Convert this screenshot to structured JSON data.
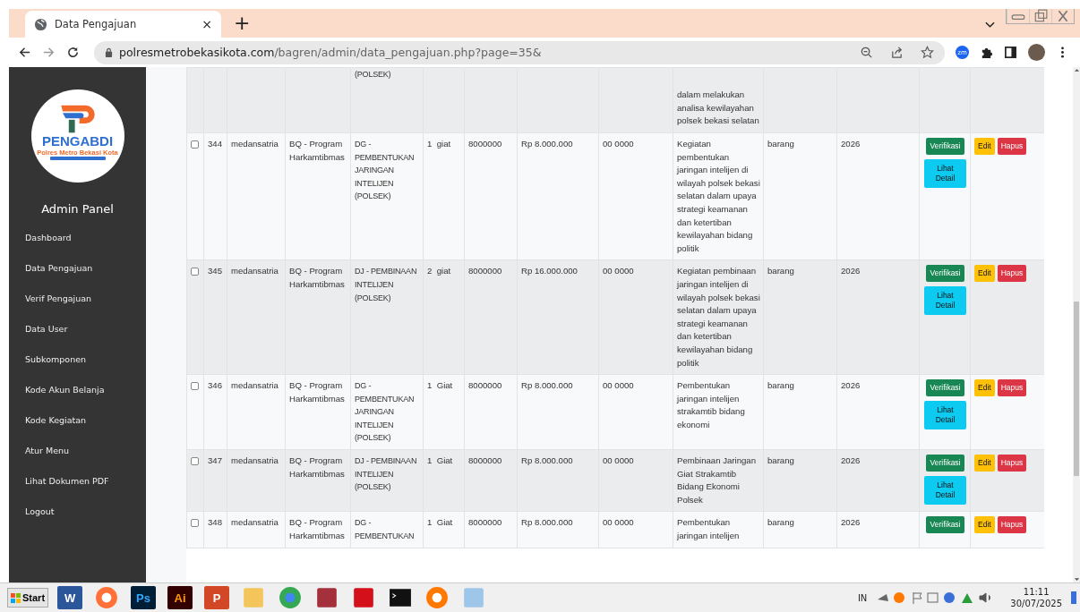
{
  "browser": {
    "tab_title": "Data Pengajuan",
    "tab_close": "×",
    "new_tab": "+",
    "url_host": "polresmetrobekasikota.com",
    "url_path": "/bagren/admin/data_pengajuan.php?page=35&",
    "extension_label": "zm"
  },
  "sidebar": {
    "logo_text": "PENGABDI",
    "logo_subtitle": "Polres Metro Bekasi Kota",
    "title": "Admin Panel",
    "items": [
      {
        "label": "Dashboard",
        "selected": false
      },
      {
        "label": "Data Pengajuan",
        "selected": false
      },
      {
        "label": "Verif Pengajuan",
        "selected": false
      },
      {
        "label": "Data User",
        "selected": false
      },
      {
        "label": "Subkomponen",
        "selected": false
      },
      {
        "label": "Kode Akun Belanja",
        "selected": false
      },
      {
        "label": "Kode Kegiatan",
        "selected": false
      },
      {
        "label": "Atur Menu",
        "selected": false
      },
      {
        "label": "Lihat Dokumen PDF",
        "selected": false
      },
      {
        "label": "Logout",
        "selected": false
      }
    ]
  },
  "table": {
    "rows": [
      {
        "kegiatan": "(POLSEK)",
        "uraian": "dalam melakukan analisa kewilayahan polsek bekasi selatan"
      },
      {
        "checked": false,
        "no": "344",
        "user": "medansatria",
        "program": "BQ - Program Harkamtibmas",
        "kegiatan": "DG - PEMBENTUKAN JARINGAN INTELIJEN (POLSEK)",
        "volume": "1  giat",
        "harga": "8000000",
        "total": "Rp 8.000.000",
        "kode": "00 0000",
        "uraian": "Kegiatan pembentukan jaringan intelijen di wilayah polsek bekasi selatan dalam upaya strategi keamanan dan ketertiban kewilayahan bidang politik",
        "jenis": "barang",
        "tahun": "2026",
        "verif": [
          {
            "kind": "verify",
            "label": "Verifikasi"
          },
          {
            "kind": "detail",
            "label": "Lihat Detail"
          }
        ],
        "aksi": [
          {
            "kind": "edit",
            "label": "Edit"
          },
          {
            "kind": "delete",
            "label": "Hapus"
          }
        ]
      },
      {
        "checked": false,
        "no": "345",
        "user": "medansatria",
        "program": "BQ - Program Harkamtibmas",
        "kegiatan": "DJ - PEMBINAAN INTELIJEN (POLSEK)",
        "volume": "2  giat",
        "harga": "8000000",
        "total": "Rp 16.000.000",
        "kode": "00 0000",
        "uraian": "Kegiatan pembinaan jaringan intelijen di wilayah polsek bekasi selatan dalam upaya strategi keamanan dan ketertiban kewilayahan bidang politik",
        "jenis": "barang",
        "tahun": "2026",
        "verif": [
          {
            "kind": "verify",
            "label": "Verifikasi"
          },
          {
            "kind": "detail",
            "label": "Lihat Detail"
          }
        ],
        "aksi": [
          {
            "kind": "edit",
            "label": "Edit"
          },
          {
            "kind": "delete",
            "label": "Hapus"
          }
        ]
      },
      {
        "checked": false,
        "no": "346",
        "user": "medansatria",
        "program": "BQ - Program Harkamtibmas",
        "kegiatan": "DG - PEMBENTUKAN JARINGAN INTELIJEN (POLSEK)",
        "volume": "1  Giat",
        "harga": "8000000",
        "total": "Rp 8.000.000",
        "kode": "00 0000",
        "uraian": "Pembentukan jaringan intelijen strakamtib bidang ekonomi",
        "jenis": "barang",
        "tahun": "2026",
        "verif": [
          {
            "kind": "verify",
            "label": "Verifikasi"
          },
          {
            "kind": "detail",
            "label": "Lihat Detail"
          }
        ],
        "aksi": [
          {
            "kind": "edit",
            "label": "Edit"
          },
          {
            "kind": "delete",
            "label": "Hapus"
          }
        ]
      },
      {
        "checked": false,
        "no": "347",
        "user": "medansatria",
        "program": "BQ - Program Harkamtibmas",
        "kegiatan": "DJ - PEMBINAAN INTELIJEN (POLSEK)",
        "volume": "1  Giat",
        "harga": "8000000",
        "total": "Rp 8.000.000",
        "kode": "00 0000",
        "uraian": "Pembinaan Jaringan Giat Strakamtib Bidang Ekonomi Polsek",
        "jenis": "barang",
        "tahun": "2026",
        "verif": [
          {
            "kind": "verify",
            "label": "Verifikasi"
          },
          {
            "kind": "detail",
            "label": "Lihat Detail"
          }
        ],
        "aksi": [
          {
            "kind": "edit",
            "label": "Edit"
          },
          {
            "kind": "delete",
            "label": "Hapus"
          }
        ]
      },
      {
        "checked": false,
        "no": "348",
        "user": "medansatria",
        "program": "BQ - Program Harkamtibmas",
        "kegiatan": "DG - PEMBENTUKAN",
        "volume": "1  Giat",
        "harga": "8000000",
        "total": "Rp 8.000.000",
        "kode": "00 0000",
        "uraian": "Pembentukan jaringan intelijen",
        "jenis": "barang",
        "tahun": "2026",
        "verif": [
          {
            "kind": "verify",
            "label": "Verifikasi"
          }
        ],
        "aksi": [
          {
            "kind": "edit",
            "label": "Edit"
          },
          {
            "kind": "delete",
            "label": "Hapus"
          }
        ]
      }
    ]
  },
  "taskbar": {
    "start": "Start",
    "apps": [
      {
        "kind": "word",
        "label": "W"
      },
      {
        "kind": "firefox"
      },
      {
        "kind": "photoshop",
        "label": "Ps"
      },
      {
        "kind": "illustrator",
        "label": "Ai"
      },
      {
        "kind": "powerpoint",
        "label": "P"
      },
      {
        "kind": "folder"
      },
      {
        "kind": "chrome"
      },
      {
        "kind": "winrar"
      },
      {
        "kind": "pdf"
      },
      {
        "kind": "terminal"
      },
      {
        "kind": "avast"
      },
      {
        "kind": "monitor"
      }
    ],
    "language": "IN",
    "time": "11:11",
    "date": "30/07/2025"
  }
}
